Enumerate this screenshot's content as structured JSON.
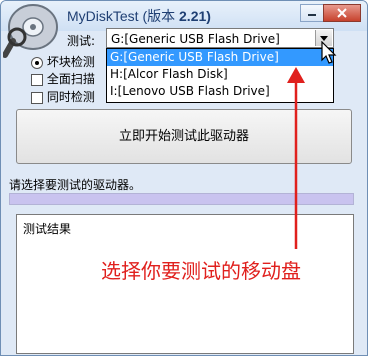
{
  "window": {
    "title": "MyDiskTest (版本",
    "version": "2.21)"
  },
  "drive_picker": {
    "label": "测试:",
    "selected": "G:[Generic USB Flash Drive]",
    "options": [
      "G:[Generic USB Flash Drive]",
      "H:[Alcor Flash Disk]",
      "I:[Lenovo USB Flash Drive]"
    ]
  },
  "options": {
    "bad_block": "坏块检测",
    "full_scan": "全面扫描",
    "simultaneous": "同时检测"
  },
  "start_button": "立即开始测试此驱动器",
  "prompt": "请选择要测试的驱动器。",
  "results_title": "测试结果",
  "annotation": "选择你要测试的移动盘",
  "colors": {
    "annotation": "#e0201d",
    "highlight": "#3399ff",
    "progress": "#c9c3ef"
  }
}
